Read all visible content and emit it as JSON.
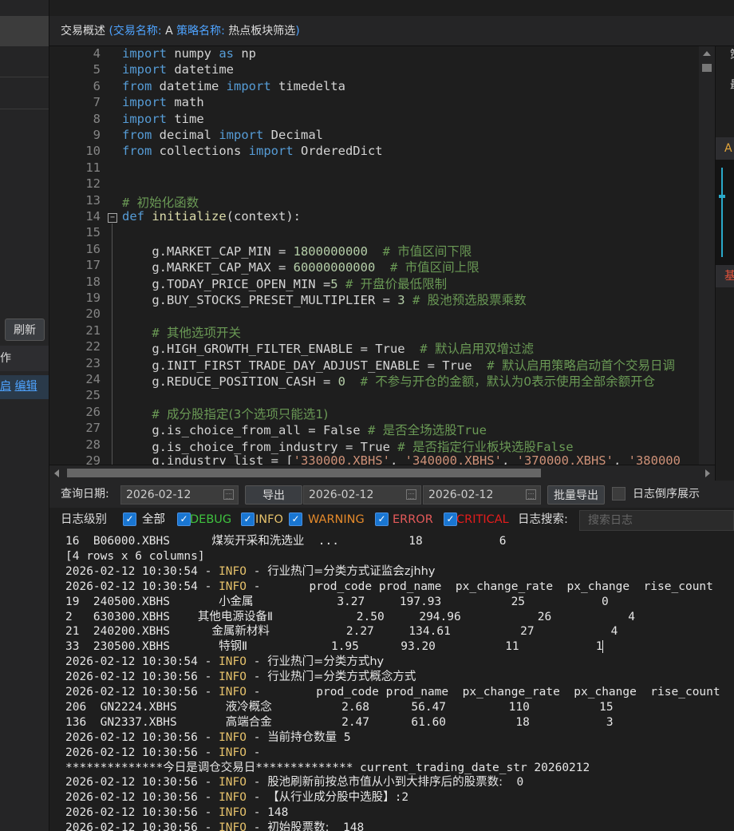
{
  "header": {
    "overview": "交易概述",
    "paren_open": "(",
    "trade_name_label": "交易名称:",
    "trade_name": "A",
    "strategy_name_label": "策略名称:",
    "strategy_name": "热点板块筛选",
    "paren_close": ")"
  },
  "left_panel": {
    "refresh_label": "刷新",
    "row_header_text": "作",
    "row_link_partial": "启",
    "row_link_edit": "编辑"
  },
  "right_panel": {
    "text1": "策",
    "text2": "最",
    "tab_a": "A",
    "tab_b": "基"
  },
  "editor": {
    "line_numbers": [
      "4",
      "5",
      "6",
      "7",
      "8",
      "9",
      "10",
      "11",
      "12",
      "13",
      "14",
      "15",
      "16",
      "17",
      "18",
      "19",
      "20",
      "21",
      "22",
      "23",
      "24",
      "25",
      "26",
      "27",
      "28",
      "29"
    ],
    "lines": [
      [
        {
          "t": "kw",
          "v": "import"
        },
        {
          "t": "",
          "v": " numpy "
        },
        {
          "t": "kw",
          "v": "as"
        },
        {
          "t": "",
          "v": " np"
        }
      ],
      [
        {
          "t": "kw",
          "v": "import"
        },
        {
          "t": "",
          "v": " datetime"
        }
      ],
      [
        {
          "t": "kw",
          "v": "from"
        },
        {
          "t": "",
          "v": " datetime "
        },
        {
          "t": "kw",
          "v": "import"
        },
        {
          "t": "",
          "v": " timedelta"
        }
      ],
      [
        {
          "t": "kw",
          "v": "import"
        },
        {
          "t": "",
          "v": " math"
        }
      ],
      [
        {
          "t": "kw",
          "v": "import"
        },
        {
          "t": "",
          "v": " time"
        }
      ],
      [
        {
          "t": "kw",
          "v": "from"
        },
        {
          "t": "",
          "v": " decimal "
        },
        {
          "t": "kw",
          "v": "import"
        },
        {
          "t": "",
          "v": " Decimal"
        }
      ],
      [
        {
          "t": "kw",
          "v": "from"
        },
        {
          "t": "",
          "v": " collections "
        },
        {
          "t": "kw",
          "v": "import"
        },
        {
          "t": "",
          "v": " OrderedDict"
        }
      ],
      [],
      [],
      [
        {
          "t": "cm",
          "v": "# "
        },
        {
          "t": "cm2",
          "v": "初始化函数"
        }
      ],
      [
        {
          "t": "kw",
          "v": "def"
        },
        {
          "t": "",
          "v": " "
        },
        {
          "t": "fn",
          "v": "initialize"
        },
        {
          "t": "",
          "v": "(context):"
        }
      ],
      [],
      [
        {
          "t": "",
          "v": "    g.MARKET_CAP_MIN = "
        },
        {
          "t": "num",
          "v": "1800000000"
        },
        {
          "t": "cm",
          "v": "  # "
        },
        {
          "t": "cm2",
          "v": "市值区间下限"
        }
      ],
      [
        {
          "t": "",
          "v": "    g.MARKET_CAP_MAX = "
        },
        {
          "t": "num",
          "v": "60000000000"
        },
        {
          "t": "cm",
          "v": "  # "
        },
        {
          "t": "cm2",
          "v": "市值区间上限"
        }
      ],
      [
        {
          "t": "",
          "v": "    g.TODAY_PRICE_OPEN_MIN ="
        },
        {
          "t": "num",
          "v": "5"
        },
        {
          "t": "cm",
          "v": " # "
        },
        {
          "t": "cm2",
          "v": "开盘价最低限制"
        }
      ],
      [
        {
          "t": "",
          "v": "    g.BUY_STOCKS_PRESET_MULTIPLIER = "
        },
        {
          "t": "num",
          "v": "3"
        },
        {
          "t": "cm",
          "v": " # "
        },
        {
          "t": "cm2",
          "v": "股池预选股票乘数"
        }
      ],
      [],
      [
        {
          "t": "cm",
          "v": "    # "
        },
        {
          "t": "cm2",
          "v": "其他选项开关"
        }
      ],
      [
        {
          "t": "",
          "v": "    g.HIGH_GROWTH_FILTER_ENABLE = True"
        },
        {
          "t": "cm",
          "v": "  # "
        },
        {
          "t": "cm2",
          "v": "默认启用双增过滤"
        }
      ],
      [
        {
          "t": "",
          "v": "    g.INIT_FIRST_TRADE_DAY_ADJUST_ENABLE = True"
        },
        {
          "t": "cm",
          "v": "  # "
        },
        {
          "t": "cm2",
          "v": "默认启用策略启动首个交易日调"
        }
      ],
      [
        {
          "t": "",
          "v": "    g.REDUCE_POSITION_CASH = "
        },
        {
          "t": "num",
          "v": "0"
        },
        {
          "t": "cm",
          "v": "  # "
        },
        {
          "t": "cm2",
          "v": "不参与开仓的金额，默认为0表示使用全部余额开仓"
        }
      ],
      [],
      [
        {
          "t": "cm",
          "v": "    # "
        },
        {
          "t": "cm2",
          "v": "成分股指定(3个选项只能选1)"
        }
      ],
      [
        {
          "t": "",
          "v": "    g.is_choice_from_all = False"
        },
        {
          "t": "cm",
          "v": " # "
        },
        {
          "t": "cm2",
          "v": "是否全场选股"
        },
        {
          "t": "cm",
          "v": "True"
        }
      ],
      [
        {
          "t": "",
          "v": "    g.is_choice_from_industry = True"
        },
        {
          "t": "cm",
          "v": " # "
        },
        {
          "t": "cm2",
          "v": "是否指定行业板块选股"
        },
        {
          "t": "cm",
          "v": "False"
        }
      ],
      [
        {
          "t": "",
          "v": "    g.industry_list = ["
        },
        {
          "t": "str",
          "v": "'330000.XBHS'"
        },
        {
          "t": "",
          "v": ", "
        },
        {
          "t": "str",
          "v": "'340000.XBHS'"
        },
        {
          "t": "",
          "v": ", "
        },
        {
          "t": "str",
          "v": "'370000.XBHS'"
        },
        {
          "t": "",
          "v": ", "
        },
        {
          "t": "str",
          "v": "'380000"
        }
      ]
    ]
  },
  "toolbar": {
    "query_date_label": "查询日期:",
    "query_date": "2026-02-12",
    "export_label": "导出",
    "from_date": "2026-02-12",
    "to_date": "2026-02-12",
    "batch_export_label": "批量导出",
    "reverse_label": "日志倒序展示"
  },
  "filter": {
    "level_label": "日志级别",
    "levels": [
      {
        "label": "全部",
        "color": "#e6e6e6"
      },
      {
        "label": "DEBUG",
        "color": "#3fc13f"
      },
      {
        "label": "INFO",
        "color": "#e5c16b"
      },
      {
        "label": "WARNING",
        "color": "#e58a2b"
      },
      {
        "label": "ERROR",
        "color": "#e55a5a"
      },
      {
        "label": "CRITICAL",
        "color": "#e51c1c"
      }
    ],
    "search_label": "日志搜索:",
    "search_placeholder": "搜索日志"
  },
  "log": {
    "lines": [
      [
        {
          "t": "",
          "v": "16  B06000.XBHS      "
        },
        {
          "t": "cn",
          "v": "煤炭开采和洗选业"
        },
        {
          "t": "",
          "v": "  ...          18           6"
        }
      ],
      [
        {
          "t": "",
          "v": "[4 rows x 6 columns]"
        }
      ],
      [
        {
          "t": "",
          "v": "2026-02-12 10:30:54 - "
        },
        {
          "t": "info",
          "v": "INFO"
        },
        {
          "t": "",
          "v": " - "
        },
        {
          "t": "cn",
          "v": "行业热门=分类方式证监会zjhhy"
        }
      ],
      [
        {
          "t": "",
          "v": "2026-02-12 10:30:54 - "
        },
        {
          "t": "info",
          "v": "INFO"
        },
        {
          "t": "",
          "v": " -       prod_code prod_name  px_change_rate  px_change  rise_count"
        }
      ],
      [
        {
          "t": "",
          "v": "19  240500.XBHS       "
        },
        {
          "t": "cn",
          "v": "小金属"
        },
        {
          "t": "",
          "v": "            3.27     197.93          25           0"
        }
      ],
      [
        {
          "t": "",
          "v": "2   630300.XBHS    "
        },
        {
          "t": "cn",
          "v": "其他电源设备Ⅱ"
        },
        {
          "t": "",
          "v": "            2.50     294.96           26           4"
        }
      ],
      [
        {
          "t": "",
          "v": "21  240200.XBHS      "
        },
        {
          "t": "cn",
          "v": "金属新材料"
        },
        {
          "t": "",
          "v": "           2.27     134.61          27           4"
        }
      ],
      [
        {
          "t": "",
          "v": "33  230500.XBHS       "
        },
        {
          "t": "cn",
          "v": "特钢Ⅱ"
        },
        {
          "t": "",
          "v": "            1.95      93.20          11           1"
        },
        {
          "t": "caret",
          "v": ""
        }
      ],
      [
        {
          "t": "",
          "v": "2026-02-12 10:30:54 - "
        },
        {
          "t": "info",
          "v": "INFO"
        },
        {
          "t": "",
          "v": " - "
        },
        {
          "t": "cn",
          "v": "行业热门=分类方式hy"
        }
      ],
      [
        {
          "t": "",
          "v": "2026-02-12 10:30:56 - "
        },
        {
          "t": "info",
          "v": "INFO"
        },
        {
          "t": "",
          "v": " - "
        },
        {
          "t": "cn",
          "v": "行业热门=分类方式概念方式"
        }
      ],
      [
        {
          "t": "",
          "v": "2026-02-12 10:30:56 - "
        },
        {
          "t": "info",
          "v": "INFO"
        },
        {
          "t": "",
          "v": " -        prod_code prod_name  px_change_rate  px_change  rise_count"
        }
      ],
      [
        {
          "t": "",
          "v": "206  GN2224.XBHS       "
        },
        {
          "t": "cn",
          "v": "液冷概念"
        },
        {
          "t": "",
          "v": "          2.68      56.47         110          15"
        }
      ],
      [
        {
          "t": "",
          "v": "136  GN2337.XBHS       "
        },
        {
          "t": "cn",
          "v": "高端合金"
        },
        {
          "t": "",
          "v": "          2.47      61.60          18           3"
        }
      ],
      [
        {
          "t": "",
          "v": "2026-02-12 10:30:56 - "
        },
        {
          "t": "info",
          "v": "INFO"
        },
        {
          "t": "",
          "v": " - "
        },
        {
          "t": "cn",
          "v": "当前持仓数量"
        },
        {
          "t": "",
          "v": " 5"
        }
      ],
      [
        {
          "t": "",
          "v": "2026-02-12 10:30:56 - "
        },
        {
          "t": "info",
          "v": "INFO"
        },
        {
          "t": "",
          "v": " -"
        }
      ],
      [
        {
          "t": "",
          "v": "**************"
        },
        {
          "t": "cn",
          "v": "今日是调仓交易日"
        },
        {
          "t": "",
          "v": "************** current_trading_date_str 20260212"
        }
      ],
      [
        {
          "t": "",
          "v": "2026-02-12 10:30:56 - "
        },
        {
          "t": "info",
          "v": "INFO"
        },
        {
          "t": "",
          "v": " - "
        },
        {
          "t": "cn",
          "v": "股池刷新前按总市值从小到大排序后的股票数:"
        },
        {
          "t": "",
          "v": "  0"
        }
      ],
      [
        {
          "t": "",
          "v": "2026-02-12 10:30:56 - "
        },
        {
          "t": "info",
          "v": "INFO"
        },
        {
          "t": "",
          "v": " - "
        },
        {
          "t": "cn",
          "v": "【从行业成分股中选股】"
        },
        {
          "t": "",
          "v": ":2"
        }
      ],
      [
        {
          "t": "",
          "v": "2026-02-12 10:30:56 - "
        },
        {
          "t": "info",
          "v": "INFO"
        },
        {
          "t": "",
          "v": " - 148"
        }
      ],
      [
        {
          "t": "",
          "v": "2026-02-12 10:30:56 - "
        },
        {
          "t": "info",
          "v": "INFO"
        },
        {
          "t": "",
          "v": " - "
        },
        {
          "t": "cn",
          "v": "初始股票数:"
        },
        {
          "t": "",
          "v": "  148"
        }
      ]
    ]
  }
}
